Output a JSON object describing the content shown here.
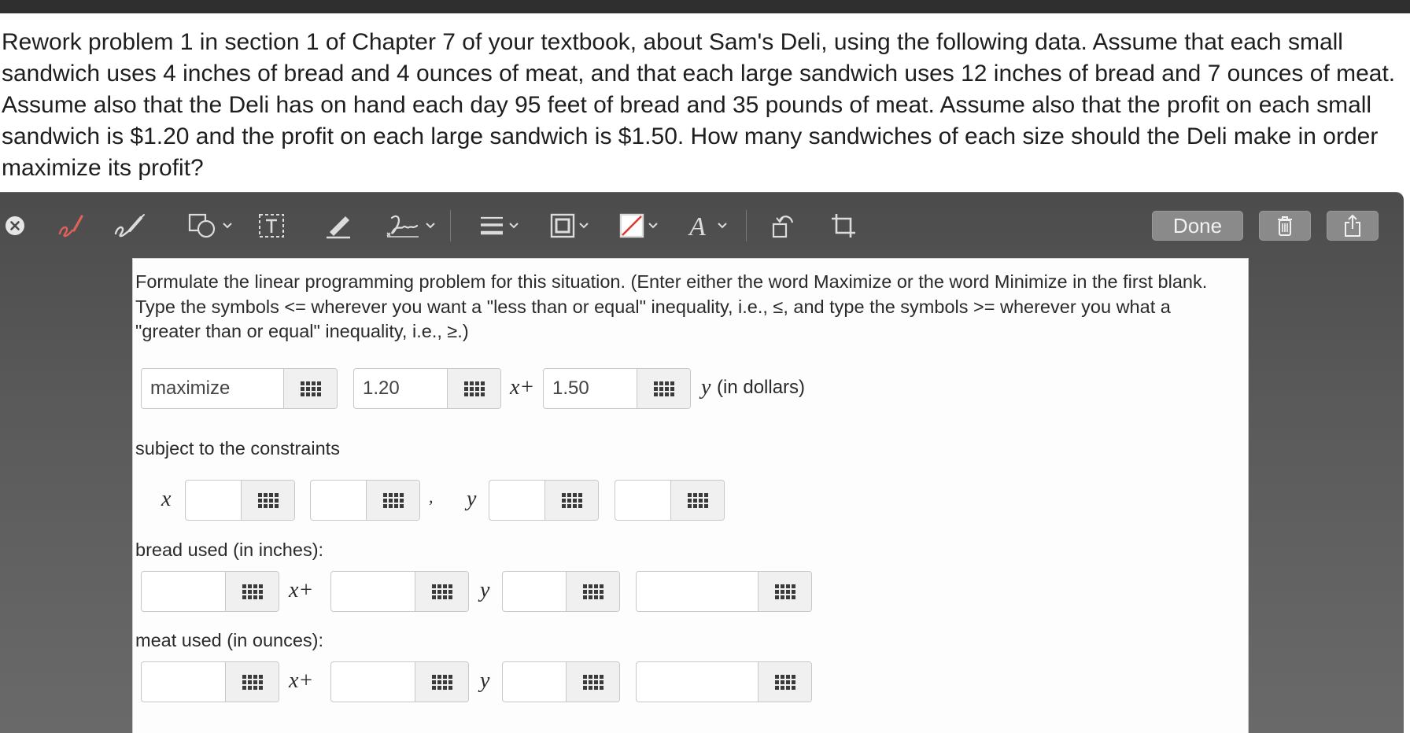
{
  "problem": {
    "text": "Rework problem 1 in section 1 of Chapter 7 of your textbook, about Sam's Deli, using the following data. Assume that each small sandwich uses 4 inches of bread and 4 ounces of meat, and that each large sandwich uses 12 inches of bread and 7 ounces of meat. Assume also that the Deli has on hand each day 95 feet of bread and 35 pounds of meat. Assume also that the profit on each small sandwich is $1.20 and the profit on each large sandwich is $1.50. How many sandwiches of each size should the Deli make in order maximize its profit?"
  },
  "toolbar": {
    "done_label": "Done",
    "tools": [
      "close-icon",
      "sketch-icon",
      "draw-icon",
      "shapes-icon",
      "text-box-icon",
      "highlight-icon",
      "signature-icon",
      "line-style-icon",
      "border-color-icon",
      "fill-color-icon",
      "text-style-icon",
      "rotate-icon",
      "crop-icon",
      "trash-icon",
      "share-icon"
    ],
    "accent_color": "#e0605a"
  },
  "form": {
    "instructions": "Formulate the linear programming problem for this situation. (Enter either the word Maximize or the word Minimize in the first blank. Type the symbols <= wherever you want a \"less than or equal\" inequality, i.e., ≤, and type the symbols >= wherever you what a \"greater than or equal\" inequality, i.e., ≥.)",
    "objective": {
      "sense_value": "maximize",
      "coef_x_value": "1.20",
      "x_plus": "x+",
      "coef_y_value": "1.50",
      "y_label": "y",
      "units": "(in dollars)"
    },
    "subject_to": "subject to the constraints",
    "nonneg": {
      "x_label": "x",
      "comma": ",",
      "y_label": "y",
      "values": [
        "",
        "",
        "",
        ""
      ]
    },
    "bread": {
      "label": "bread used (in inches):",
      "x_plus": "x+",
      "y_label": "y",
      "values": [
        "",
        "",
        "",
        ""
      ]
    },
    "meat": {
      "label": "meat used (in ounces):",
      "x_plus": "x+",
      "y_label": "y",
      "values": [
        "",
        "",
        "",
        ""
      ]
    }
  }
}
